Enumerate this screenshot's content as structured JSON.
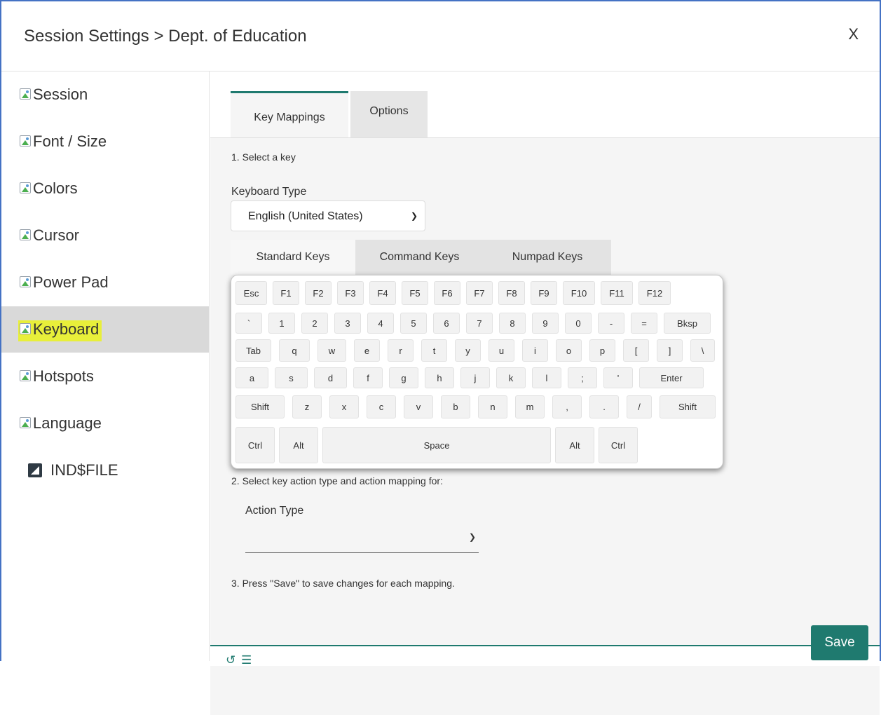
{
  "header": {
    "title": "Session Settings > Dept. of Education",
    "close_label": "X"
  },
  "sidebar": {
    "items": [
      {
        "label": "Session",
        "icon": "image-icon"
      },
      {
        "label": "Font / Size",
        "icon": "image-icon"
      },
      {
        "label": "Colors",
        "icon": "image-icon"
      },
      {
        "label": "Cursor",
        "icon": "image-icon"
      },
      {
        "label": "Power Pad",
        "icon": "image-icon"
      },
      {
        "label": "Keyboard",
        "icon": "image-icon",
        "active": true
      },
      {
        "label": "Hotspots",
        "icon": "image-icon"
      },
      {
        "label": "Language",
        "icon": "image-icon"
      },
      {
        "label": "IND$FILE",
        "icon": "file-transfer-icon"
      }
    ],
    "highlight_color": "#e8ef3a",
    "active_bg": "#d9d9d9"
  },
  "main": {
    "tabs": [
      {
        "label": "Key Mappings",
        "active": true
      },
      {
        "label": "Options",
        "active": false
      }
    ],
    "step1": "1. Select a key",
    "keyboard_type_label": "Keyboard Type",
    "keyboard_type_value": "English (United States)",
    "keyboard_tabs": [
      {
        "label": "Standard Keys",
        "active": true
      },
      {
        "label": "Command Keys",
        "active": false
      },
      {
        "label": "Numpad Keys",
        "active": false
      }
    ],
    "keys": {
      "row1": [
        "Esc",
        "F1",
        "F2",
        "F3",
        "F4",
        "F5",
        "F6",
        "F7",
        "F8",
        "F9",
        "F10",
        "F11",
        "F12"
      ],
      "row2": [
        "`",
        "1",
        "2",
        "3",
        "4",
        "5",
        "6",
        "7",
        "8",
        "9",
        "0",
        "-",
        "=",
        "Bksp"
      ],
      "row3": [
        "Tab",
        "q",
        "w",
        "e",
        "r",
        "t",
        "y",
        "u",
        "i",
        "o",
        "p",
        "[",
        "]",
        "\\"
      ],
      "row4": [
        "a",
        "s",
        "d",
        "f",
        "g",
        "h",
        "j",
        "k",
        "l",
        ";",
        "'",
        "Enter"
      ],
      "row5": [
        "Shift",
        "z",
        "x",
        "c",
        "v",
        "b",
        "n",
        "m",
        ",",
        ".",
        "/",
        "Shift"
      ],
      "row6": [
        "Ctrl",
        "Alt",
        "Space",
        "Alt",
        "Ctrl"
      ]
    },
    "step2": "2. Select key action type and action mapping for:",
    "action_type_label": "Action Type",
    "action_type_value": "",
    "step3": "3. Press \"Save\" to save changes for each mapping.",
    "accent": "#1f7a6f"
  },
  "footer": {
    "reset_icon": "reset-icon",
    "list_icon": "list-icon",
    "save_label": "Save"
  }
}
